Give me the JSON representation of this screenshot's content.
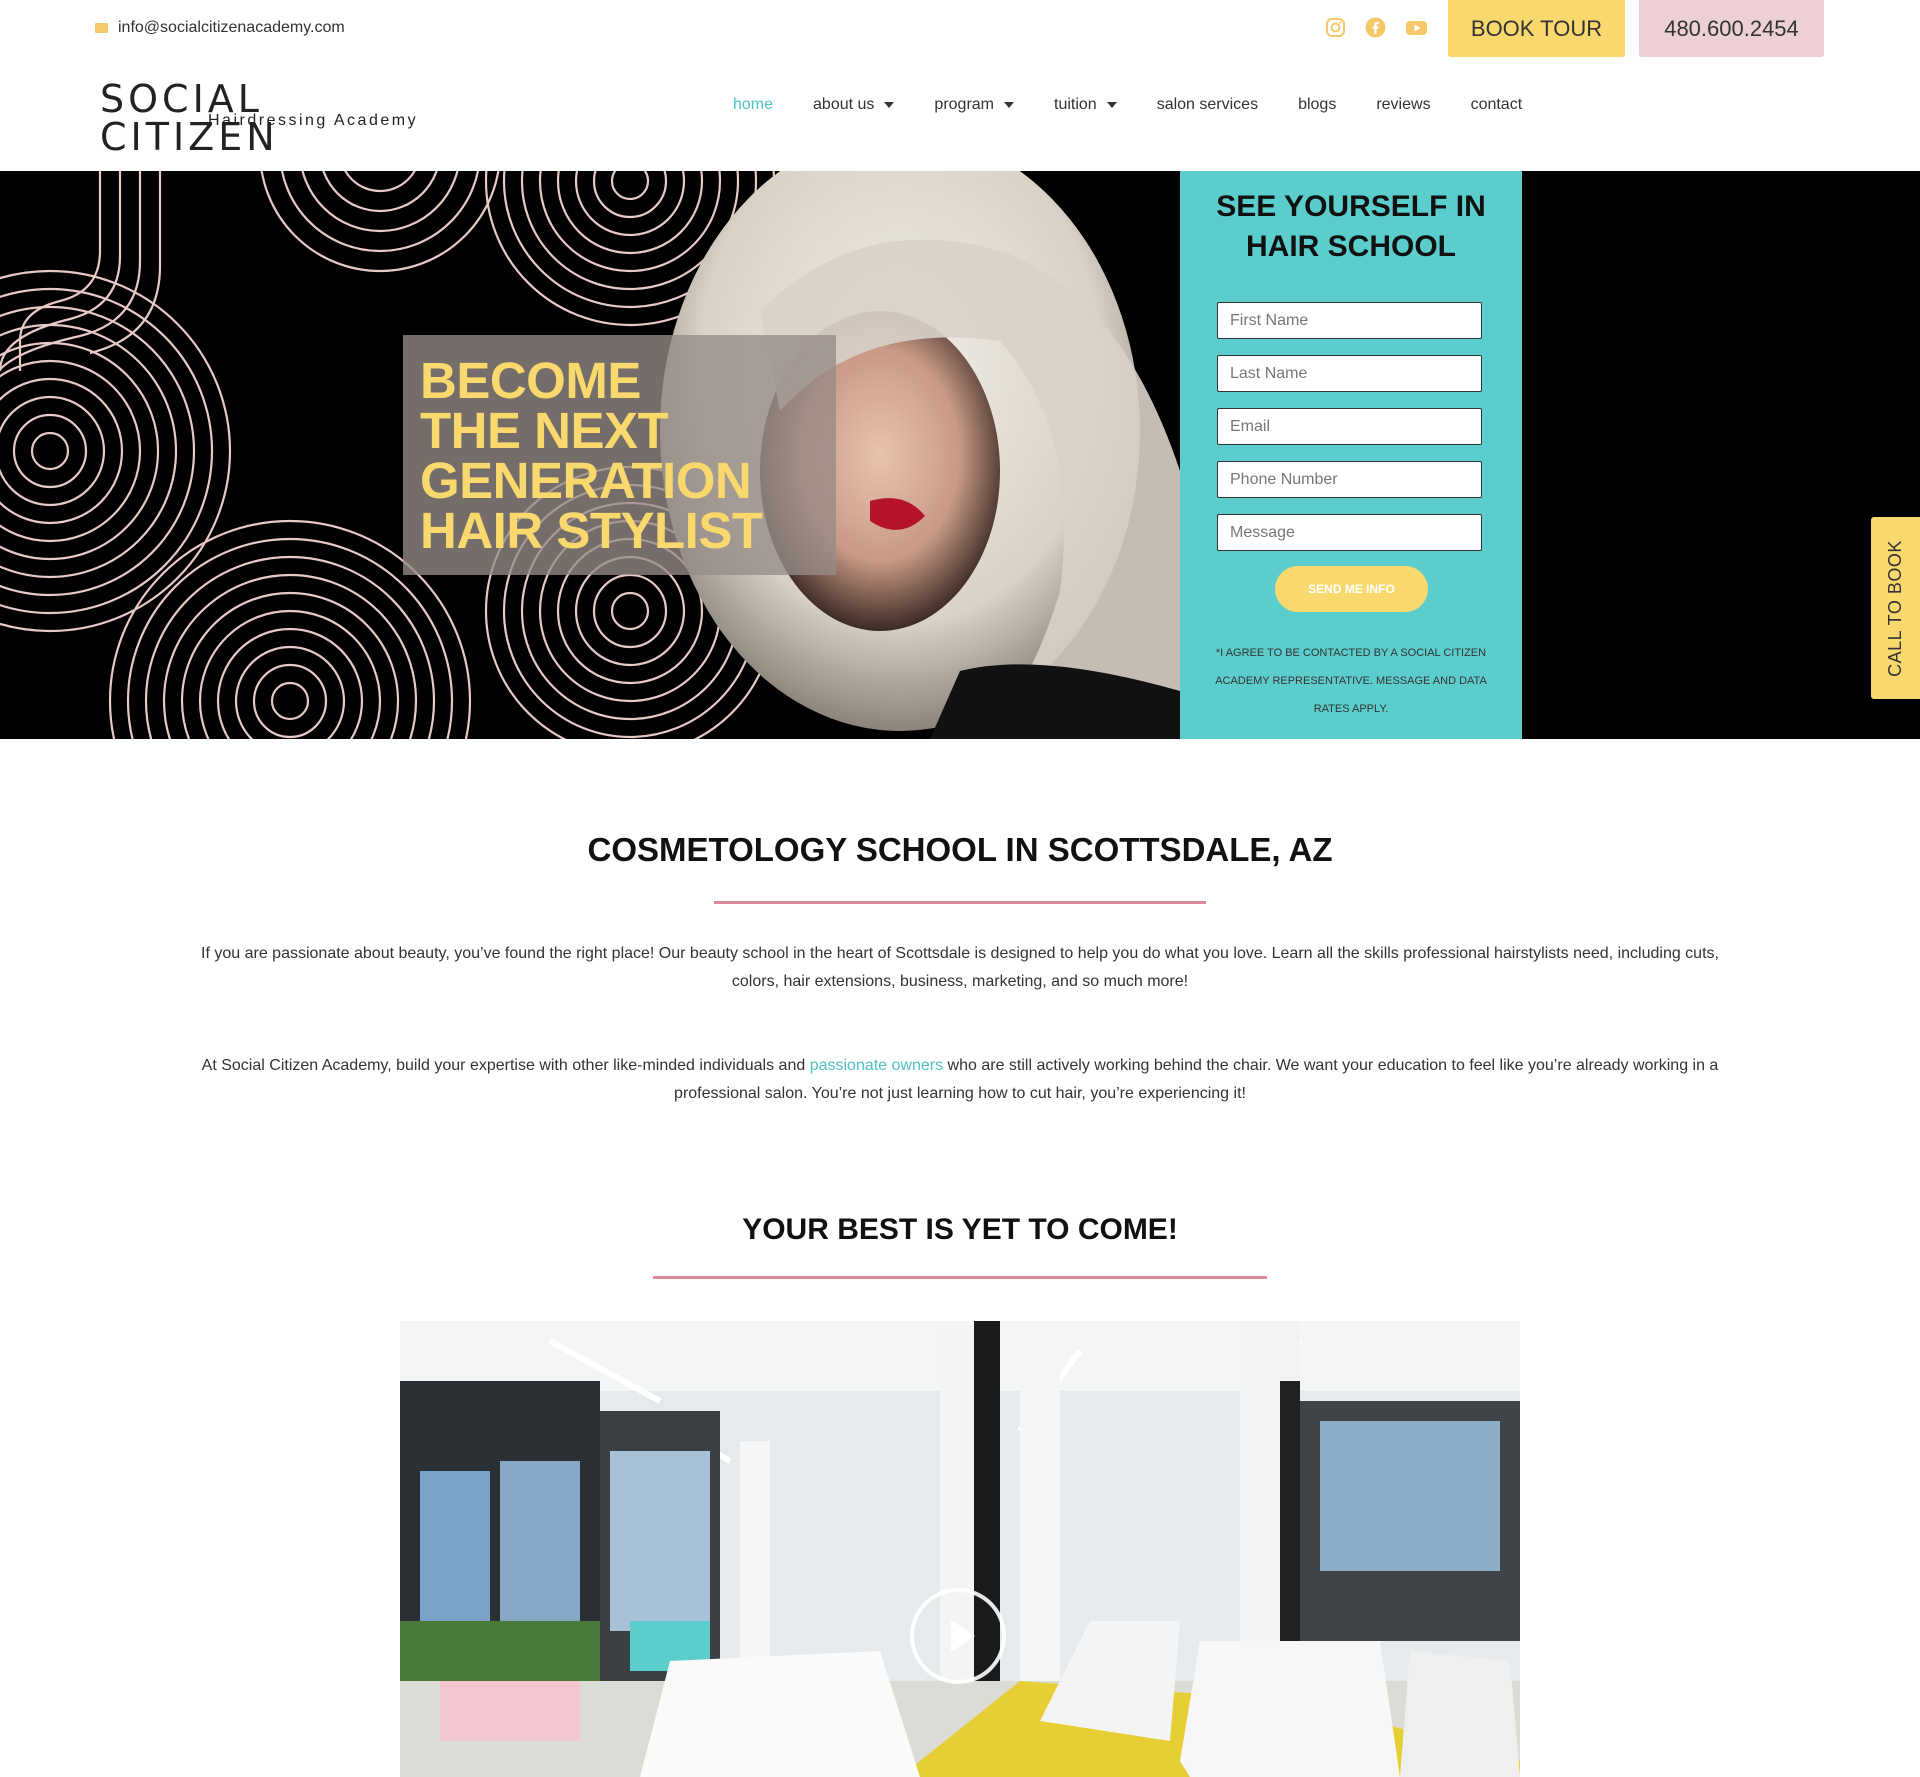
{
  "topbar": {
    "email": "info@socialcitizenacademy.com",
    "book_tour": "BOOK TOUR",
    "phone": "480.600.2454",
    "social_icons": [
      "instagram-icon",
      "facebook-icon",
      "youtube-icon"
    ]
  },
  "header": {
    "logo_main": "SOCIAL CITIZEN",
    "logo_sub": "Hairdressing Academy",
    "nav": [
      {
        "label": "home",
        "active": true,
        "dropdown": false
      },
      {
        "label": "about us",
        "active": false,
        "dropdown": true
      },
      {
        "label": "program",
        "active": false,
        "dropdown": true
      },
      {
        "label": "tuition",
        "active": false,
        "dropdown": true
      },
      {
        "label": "salon services",
        "active": false,
        "dropdown": false
      },
      {
        "label": "blogs",
        "active": false,
        "dropdown": false
      },
      {
        "label": "reviews",
        "active": false,
        "dropdown": false
      },
      {
        "label": "contact",
        "active": false,
        "dropdown": false
      }
    ]
  },
  "hero": {
    "title_lines": [
      "BECOME",
      "THE NEXT",
      "GENERATION",
      "HAIR STYLIST"
    ]
  },
  "form": {
    "title_line1": "SEE YOURSELF IN",
    "title_line2": "HAIR SCHOOL",
    "first_name_placeholder": "First Name",
    "last_name_placeholder": "Last Name",
    "email_placeholder": "Email",
    "phone_placeholder": "Phone Number",
    "message_placeholder": "Message",
    "submit": "SEND ME INFO",
    "consent_line1": "*I AGREE TO BE CONTACTED BY A SOCIAL CITIZEN",
    "consent_line2": "ACADEMY REPRESENTATIVE. MESSAGE AND DATA",
    "consent_line3": "RATES APPLY."
  },
  "side_tab": "CALL TO BOOK",
  "intro": {
    "heading": "COSMETOLOGY SCHOOL IN SCOTTSDALE, AZ",
    "para1": "If you are passionate about beauty, you’ve found the right place! Our beauty school in the heart of Scottsdale is designed to help you do what you love. Learn all the skills professional hairstylists need, including cuts, colors, hair extensions, business, marketing, and so much more!",
    "para2_before": "At Social Citizen Academy, build your expertise with other like-minded individuals and ",
    "para2_link": "passionate owners",
    "para2_after": " who are still actively working behind the chair. We want your education to feel like you’re already working in a professional salon. You’re not just learning how to cut hair, you’re experiencing it!"
  },
  "best": {
    "heading": "YOUR BEST IS YET TO COME!"
  },
  "colors": {
    "yellow": "#f9d86e",
    "teal": "#5ccdcd",
    "pink": "#ecd0d6",
    "rule": "#d98c97"
  }
}
